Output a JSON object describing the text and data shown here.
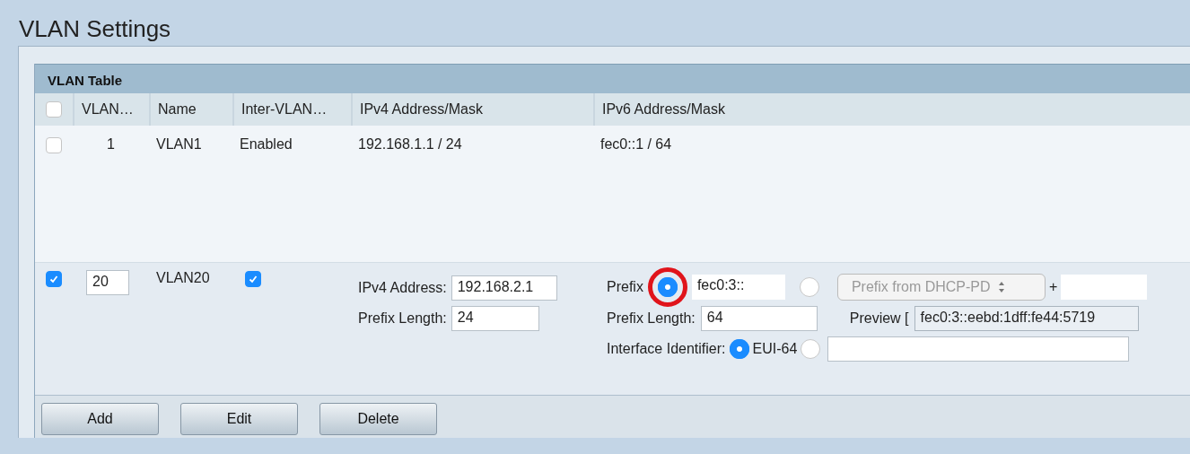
{
  "page_title": "VLAN Settings",
  "table": {
    "title": "VLAN Table",
    "select_all": {
      "checked": false
    },
    "columns": [
      "VLAN…",
      "Name",
      "Inter-VLAN…",
      "IPv4 Address/Mask",
      "IPv6 Address/Mask"
    ],
    "rows": [
      {
        "kind": "view",
        "checked": false,
        "vlan_id": "1",
        "name": "VLAN1",
        "inter_vlan": "Enabled",
        "ipv4": "192.168.1.1 / 24",
        "ipv6": "fec0::1 / 64"
      },
      {
        "kind": "edit",
        "checked": true,
        "vlan_id": "20",
        "name": "VLAN20",
        "inter_vlan_checked": true,
        "ipv4": {
          "address_label": "IPv4 Address:",
          "address": "192.168.2.1",
          "prefix_length_label": "Prefix Length:",
          "prefix_length": "24"
        },
        "ipv6": {
          "prefix_label": "Prefix",
          "prefix_options": [
            {
              "kind": "static",
              "selected": true,
              "highlighted": true,
              "value": "fec0:3::"
            },
            {
              "kind": "dhcp",
              "selected": false,
              "highlighted": false,
              "value": "Prefix from DHCP-PD",
              "disabled": true
            }
          ],
          "plus": "+",
          "prefix_length_label": "Prefix Length:",
          "prefix_length": "64",
          "preview_label": "Preview [",
          "preview": "fec0:3::eebd:1dff:fe44:5719",
          "interface_label": "Interface Identifier:",
          "interface_options": [
            {
              "kind": "eui",
              "selected": true,
              "label": "EUI-64"
            },
            {
              "kind": "custom",
              "selected": false
            }
          ]
        }
      }
    ]
  },
  "buttons": [
    "Add",
    "Edit",
    "Delete"
  ]
}
